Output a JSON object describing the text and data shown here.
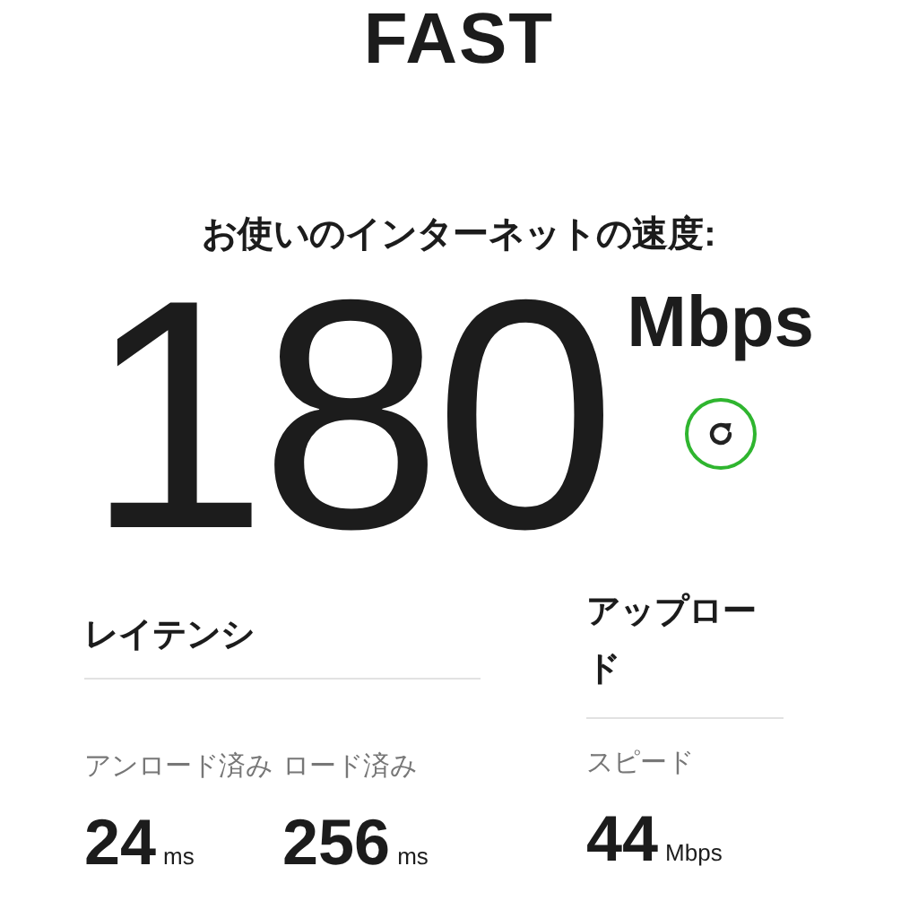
{
  "logo": "FAST",
  "headline": "お使いのインターネットの速度:",
  "speed": {
    "value": "180",
    "unit": "Mbps"
  },
  "latency": {
    "title": "レイテンシ",
    "metrics": [
      {
        "label": "アンロード済み",
        "value": "24",
        "unit": "ms"
      },
      {
        "label": "ロード済み",
        "value": "256",
        "unit": "ms"
      }
    ]
  },
  "upload": {
    "title": "アップロード",
    "label": "スピード",
    "value": "44",
    "unit": "Mbps"
  }
}
